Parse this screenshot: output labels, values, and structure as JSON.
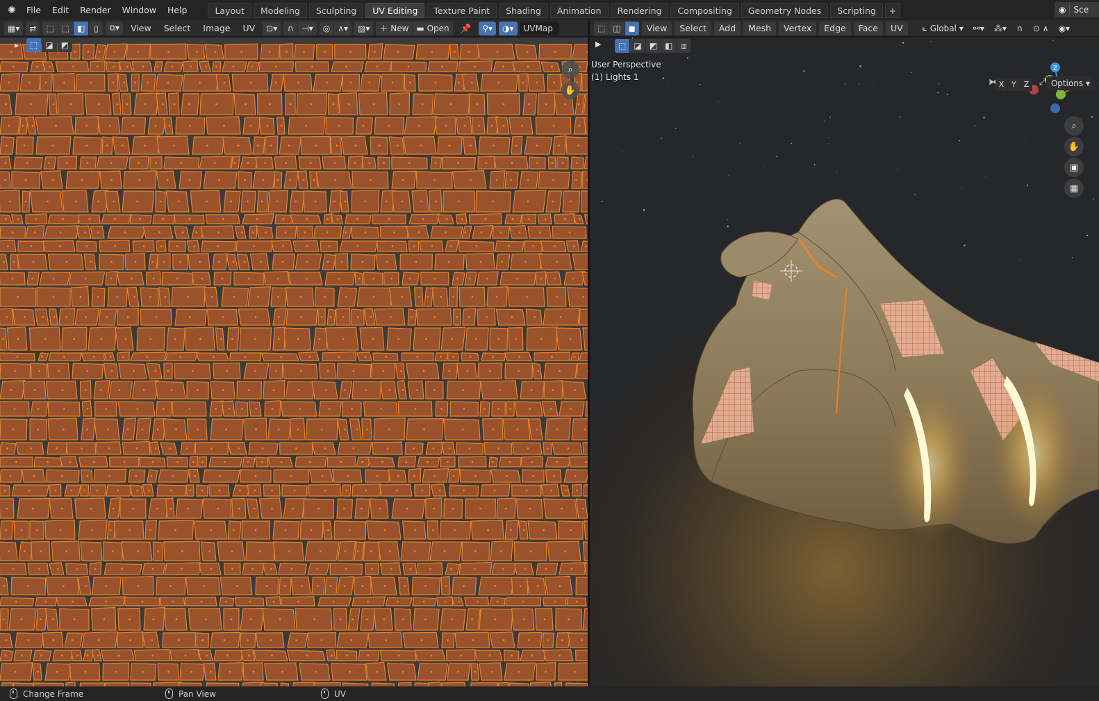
{
  "topbar": {
    "logo_icon": "blender-logo-icon",
    "menus": [
      "File",
      "Edit",
      "Render",
      "Window",
      "Help"
    ],
    "tabs": [
      "Layout",
      "Modeling",
      "Sculpting",
      "UV Editing",
      "Texture Paint",
      "Shading",
      "Animation",
      "Rendering",
      "Compositing",
      "Geometry Nodes",
      "Scripting"
    ],
    "active_tab": "UV Editing",
    "add_tab": "+",
    "scene_label": "Sce"
  },
  "uv_editor": {
    "menus": [
      "View",
      "Select",
      "Image",
      "UV"
    ],
    "new_label": "New",
    "open_label": "Open",
    "uvmap_label": "UVMap",
    "accent_color": "#e8832a",
    "island_color": "#9a522c",
    "background_color": "#3b3b3b"
  },
  "viewport": {
    "menus": [
      "View",
      "Select",
      "Add",
      "Mesh",
      "Vertex",
      "Edge",
      "Face",
      "UV"
    ],
    "transform_orientation": "Global",
    "perspective_label": "User Perspective",
    "object_label": "(1) Lights 1",
    "axis_buttons": [
      "X",
      "Y",
      "Z"
    ],
    "options_label": "Options",
    "gizmo_colors": {
      "x": "#e24a4a",
      "y": "#79b93a",
      "z": "#3f8de5"
    }
  },
  "statusbar": {
    "items": [
      "Change Frame",
      "Pan View",
      "UV"
    ]
  }
}
